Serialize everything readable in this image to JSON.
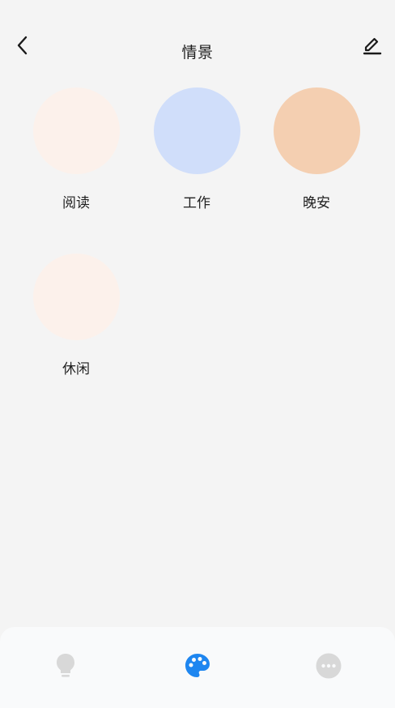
{
  "header": {
    "title": "情景",
    "back_icon": "chevron-left-icon",
    "edit_icon": "pencil-icon"
  },
  "scenes": [
    {
      "label": "阅读",
      "color": "#fcf1eb"
    },
    {
      "label": "工作",
      "color": "#d0defa"
    },
    {
      "label": "晚安",
      "color": "#f4cfb1"
    },
    {
      "label": "休闲",
      "color": "#fcf1eb"
    }
  ],
  "tabbar": {
    "tabs": [
      {
        "icon": "lightbulb-icon",
        "active": false,
        "color": "#d8d8d8"
      },
      {
        "icon": "palette-icon",
        "active": true,
        "color": "#1e86f0"
      },
      {
        "icon": "more-icon",
        "active": false,
        "color": "#d8d8d8"
      }
    ]
  }
}
